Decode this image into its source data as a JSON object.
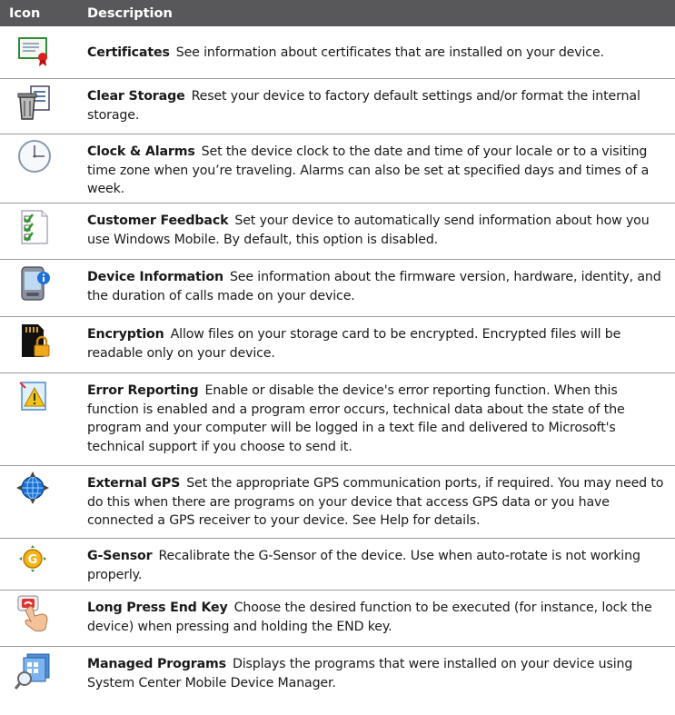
{
  "header": {
    "icon_col": "Icon",
    "desc_col": "Description"
  },
  "rows": [
    {
      "icon": "certificates-icon",
      "title": "Certificates",
      "desc": "See information about certificates that are installed on your device."
    },
    {
      "icon": "clear-storage-icon",
      "title": "Clear Storage",
      "desc": "Reset your device to factory default settings and/or format the internal storage."
    },
    {
      "icon": "clock-alarms-icon",
      "title": "Clock & Alarms",
      "desc": "Set the device clock to the date and time of your locale or to a visiting time zone when you’re traveling. Alarms can also be set at specified days and times of a week."
    },
    {
      "icon": "customer-feedback-icon",
      "title": "Customer Feedback",
      "desc": "Set your device to automatically send information about how you use Windows Mobile. By default, this option is disabled."
    },
    {
      "icon": "device-information-icon",
      "title": "Device Information",
      "desc": "See information about the firmware version, hardware, identity, and the duration of calls made on your device."
    },
    {
      "icon": "encryption-icon",
      "title": "Encryption",
      "desc": "Allow files on your storage card to be encrypted. Encrypted files will be readable only on your device."
    },
    {
      "icon": "error-reporting-icon",
      "title": "Error Reporting",
      "desc": "Enable or disable the device's error reporting function. When this function is enabled and a program error occurs, technical data about the state of the program and your computer will be logged in a text file and delivered to Microsoft's technical support if you choose to send it."
    },
    {
      "icon": "external-gps-icon",
      "title": "External GPS",
      "desc": "Set the appropriate GPS communication ports, if required. You may need to do this when there are programs on your device that access GPS data or you have connected a GPS receiver to your device. See Help for details."
    },
    {
      "icon": "g-sensor-icon",
      "title": "G-Sensor",
      "desc": "Recalibrate the G-Sensor of the device. Use when auto-rotate is not working properly."
    },
    {
      "icon": "long-press-end-key-icon",
      "title": "Long Press End Key",
      "desc": "Choose the desired function to be executed (for instance, lock the device) when pressing and holding the END key."
    },
    {
      "icon": "managed-programs-icon",
      "title": "Managed Programs",
      "desc": "Displays the programs that were installed on your device using System Center Mobile Device Manager."
    }
  ]
}
